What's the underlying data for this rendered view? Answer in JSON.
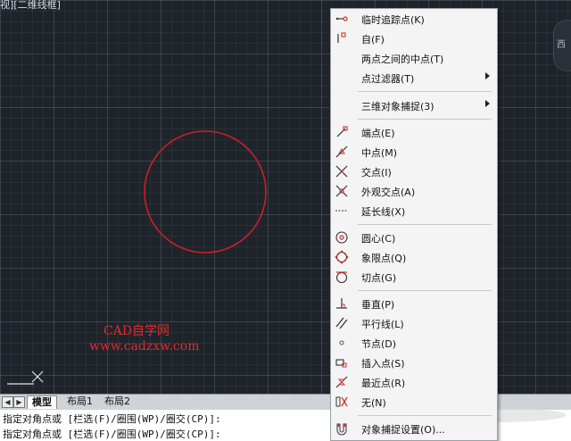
{
  "viewport": {
    "label": "视][二维线框]"
  },
  "watermark": {
    "line1": "CAD自学网",
    "line2": "www.cadzxw.com"
  },
  "right_button": {
    "label": "西"
  },
  "tabs": {
    "items": [
      "模型",
      "布局1",
      "布局2"
    ]
  },
  "command": {
    "line1": "指定对角点或 [栏选(F)/圈围(WP)/圈交(CP)]:",
    "line2": "指定对角点或 [栏选(F)/圈围(WP)/圈交(CP)]:"
  },
  "menu": {
    "temp_track": "临时追踪点(K)",
    "from": "自(F)",
    "mid_between": "两点之间的中点(T)",
    "point_filters": "点过滤器(T)",
    "snap_3d": "三维对象捕捉(3)",
    "endpoint": "端点(E)",
    "midpoint": "中点(M)",
    "intersection": "交点(I)",
    "apparent": "外观交点(A)",
    "extension": "延长线(X)",
    "center": "圆心(C)",
    "quadrant": "象限点(Q)",
    "tangent": "切点(G)",
    "perpendicular": "垂直(P)",
    "parallel": "平行线(L)",
    "node": "节点(D)",
    "insert": "插入点(S)",
    "nearest": "最近点(R)",
    "none": "无(N)",
    "osnap_settings": "对象捕捉设置(O)..."
  },
  "colors": {
    "canvas": "#1f242b",
    "circle": "#c8202a",
    "watermark": "#e12a2a"
  }
}
